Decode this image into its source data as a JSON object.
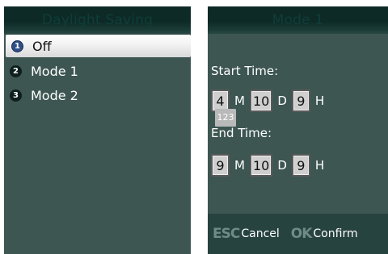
{
  "left_screen": {
    "title": "Daylight Saving",
    "items": [
      {
        "num": "1",
        "label": "Off",
        "selected": true
      },
      {
        "num": "2",
        "label": "Mode 1",
        "selected": false
      },
      {
        "num": "3",
        "label": "Mode 2",
        "selected": false
      }
    ]
  },
  "right_screen": {
    "title": "Mode 1",
    "start_label": "Start Time:",
    "start": {
      "month": "4",
      "m_unit": "M",
      "day": "10",
      "d_unit": "D",
      "hour": "9",
      "h_unit": "H"
    },
    "ime_indicator": "123",
    "end_label": "End Time:",
    "end": {
      "month": "9",
      "m_unit": "M",
      "day": "10",
      "d_unit": "D",
      "hour": "9",
      "h_unit": "H"
    },
    "footer": {
      "esc_icon": "ESC",
      "cancel_label": "Cancel",
      "ok_icon": "OK",
      "confirm_label": "Confirm"
    }
  },
  "colors": {
    "screen_bg": "#3d5652",
    "titlebar": "#0d2a26",
    "selected_bg": "#f2f2f2",
    "input_box": "#cfcfcf"
  }
}
